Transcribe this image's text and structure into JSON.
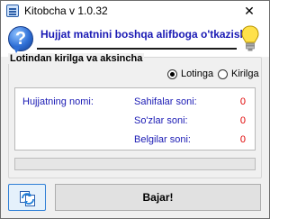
{
  "window": {
    "title": "Kitobcha v 1.0.32",
    "app_icon": "book-icon",
    "close_glyph": "✕"
  },
  "header": {
    "help_icon_glyph": "?",
    "title": "Hujjat matnini boshqa alifboga o'tkazish",
    "bulb_icon": "lightbulb-icon"
  },
  "group": {
    "legend": "Lotindan kirilga va aksincha",
    "options": [
      {
        "label": "Lotinga",
        "selected": true
      },
      {
        "label": "Kirilga",
        "selected": false
      }
    ]
  },
  "info": {
    "doc_name_label": "Hujjatning nomi:",
    "pages_label": "Sahifalar soni:",
    "pages_value": "0",
    "words_label": "So'zlar soni:",
    "words_value": "0",
    "chars_label": "Belgilar soni:",
    "chars_value": "0"
  },
  "progress": {
    "value": 0
  },
  "buttons": {
    "refresh_icon": "refresh-icon",
    "run_label": "Bajar!"
  },
  "colors": {
    "accent_text": "#1a1ab4",
    "value_text": "#e00000",
    "progress_fill": "#06b025"
  }
}
